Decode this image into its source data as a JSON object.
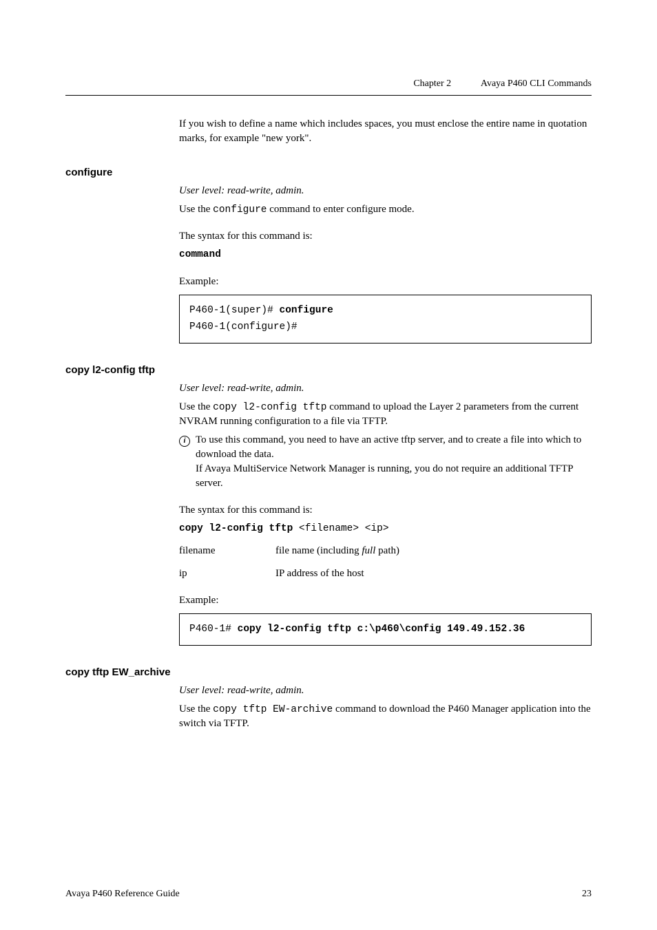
{
  "header": {
    "chapter": "Chapter 2",
    "title": "Avaya P460 CLI Commands"
  },
  "intro": {
    "text": "If you wish to define a name which includes spaces, you must enclose the entire name in quotation marks, for example \"new york\"."
  },
  "sections": {
    "configure": {
      "heading": "configure",
      "userlevel": "User level: read-write, admin.",
      "desc_prefix": "Use the ",
      "desc_code": "configure",
      "desc_suffix": " command to enter configure mode.",
      "syntax_label": "The syntax for this command is:",
      "syntax_cmd": "command",
      "example_label": "Example:",
      "example_line1a": "P460-1(super)# ",
      "example_line1b": "configure",
      "example_line2": "P460-1(configure)#"
    },
    "copyl2": {
      "heading": "copy l2-config tftp",
      "userlevel": "User level: read-write, admin.",
      "desc_prefix": "Use the ",
      "desc_code": "copy l2-config tftp",
      "desc_suffix": " command to upload the Layer 2 parameters from the current NVRAM running configuration to a file via TFTP.",
      "info_icon": "i",
      "info_text1": "To use this command, you need to have an active tftp server, and to create a file into which to download the data.",
      "info_text2": "If Avaya MultiService Network Manager is running, you do not require an additional TFTP server.",
      "syntax_label": "The syntax for this command is:",
      "syntax_cmd_bold": "copy l2-config tftp",
      "syntax_cmd_rest": " <filename> <ip>",
      "params": {
        "p1_label": "filename",
        "p1_desc_a": "file name (including ",
        "p1_desc_b": "full",
        "p1_desc_c": " path)",
        "p2_label": "ip",
        "p2_desc": "IP address of the host"
      },
      "example_label": "Example:",
      "example_line_a": "P460-1# ",
      "example_line_b": "copy l2-config tftp c:\\p460\\config 149.49.152.36"
    },
    "copytftp": {
      "heading": "copy tftp EW_archive",
      "userlevel": "User level: read-write, admin.",
      "desc_prefix": "Use the ",
      "desc_code": "copy tftp EW-archive",
      "desc_suffix": " command to download the P460 Manager application into the switch via TFTP."
    }
  },
  "footer": {
    "left": "Avaya P460 Reference Guide",
    "right": "23"
  }
}
